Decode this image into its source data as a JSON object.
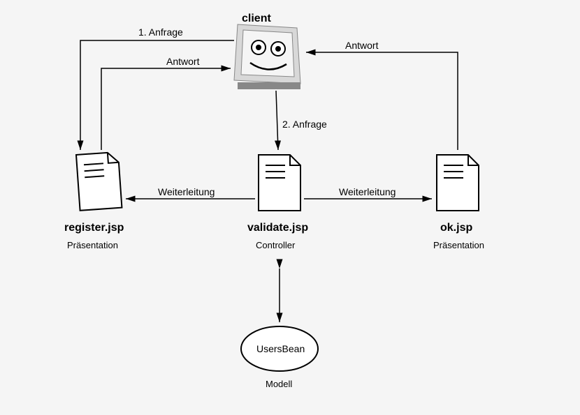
{
  "client": {
    "title": "client"
  },
  "nodes": {
    "register": {
      "title": "register.jsp",
      "subtitle": "Präsentation"
    },
    "validate": {
      "title": "validate.jsp",
      "subtitle": "Controller"
    },
    "ok": {
      "title": "ok.jsp",
      "subtitle": "Präsentation"
    },
    "usersbean": {
      "title": "UsersBean",
      "subtitle": "Modell"
    }
  },
  "edges": {
    "anfrage1": "1. Anfrage",
    "antwort1": "Antwort",
    "anfrage2": "2. Anfrage",
    "antwort2": "Antwort",
    "weiterleitung1": "Weiterleitung",
    "weiterleitung2": "Weiterleitung"
  }
}
